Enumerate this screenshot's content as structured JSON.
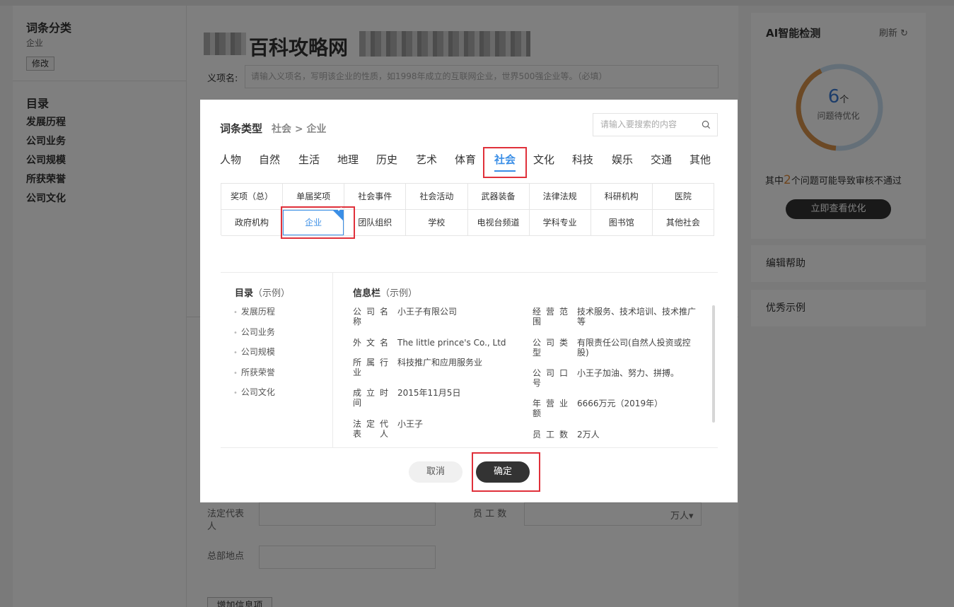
{
  "left_panel": {
    "title": "词条分类",
    "category": "企业",
    "edit_label": "修改",
    "toc_title": "目录",
    "toc": [
      "发展历程",
      "公司业务",
      "公司规模",
      "所获荣誉",
      "公司文化"
    ]
  },
  "main": {
    "title_visible": "百科攻略网",
    "yixiang_label": "义项名:",
    "yixiang_placeholder": "请输入义项名，写明该企业的性质，如1998年成立的互联网企业，世界500强企业等。（必填）",
    "fields": {
      "legal_rep_label": "法定代表人",
      "staff_label": "员 工 数",
      "staff_unit": "万人▾",
      "hq_label": "总部地点"
    },
    "add_info_label": "增加信息项"
  },
  "ai": {
    "title": "AI智能检测",
    "refresh_label": "刷新",
    "issue_count": "6",
    "issue_unit": "个",
    "issue_sub": "问题待优化",
    "warn_prefix": "其中",
    "warn_num": "2",
    "warn_suffix": "个问题可能导致审核不通过",
    "view_button": "立即查看优化",
    "colors": {
      "ring_progress": "#d9924a",
      "ring_track": "#c9dff0",
      "accent": "#3a7bd5"
    }
  },
  "help": {
    "edit_help": "编辑帮助",
    "good_examples": "优秀示例"
  },
  "modal": {
    "title": "词条类型",
    "breadcrumb": "社会 > 企业",
    "search_placeholder": "请输入要搜索的内容",
    "categories": [
      "人物",
      "自然",
      "生活",
      "地理",
      "历史",
      "艺术",
      "体育",
      "社会",
      "文化",
      "科技",
      "娱乐",
      "交通",
      "其他"
    ],
    "active_category": "社会",
    "subcategories": [
      "奖项（总）",
      "单届奖项",
      "社会事件",
      "社会活动",
      "武器装备",
      "法律法规",
      "科研机构",
      "医院",
      "政府机构",
      "企业",
      "团队组织",
      "学校",
      "电视台频道",
      "学科专业",
      "图书馆",
      "其他社会"
    ],
    "selected_subcategory": "企业",
    "example": {
      "toc_heading": "目录",
      "toc_heading_note": "（示例）",
      "toc": [
        "发展历程",
        "公司业务",
        "公司规模",
        "所获荣誉",
        "公司文化"
      ],
      "info_heading": "信息栏",
      "info_heading_note": "（示例）",
      "info_left": [
        {
          "k1": "公司名",
          "k2": "称",
          "v": "小王子有限公司"
        },
        {
          "k1": "外文名",
          "k2": "",
          "v": "The little prince's Co., Ltd"
        },
        {
          "k1": "所属行",
          "k2": "业",
          "v": "科技推广和应用服务业"
        },
        {
          "k1": "成立时",
          "k2": "间",
          "v": "2015年11月5日"
        },
        {
          "k1": "法定代",
          "k2": "表  人",
          "v": "小王子"
        }
      ],
      "info_right": [
        {
          "k1": "经营范",
          "k2": "围",
          "v": "技术服务、技术培训、技术推广等"
        },
        {
          "k1": "公司类",
          "k2": "型",
          "v": "有限责任公司(自然人投资或控股)"
        },
        {
          "k1": "公司口",
          "k2": "号",
          "v": "小王子加油、努力、拼搏。"
        },
        {
          "k1": "年营业",
          "k2": "额",
          "v": "6666万元（2019年）"
        },
        {
          "k1": "员工数",
          "k2": "",
          "v": "2万人"
        }
      ]
    },
    "cancel_label": "取消",
    "confirm_label": "确定",
    "highlight_color": "#e0303a"
  }
}
